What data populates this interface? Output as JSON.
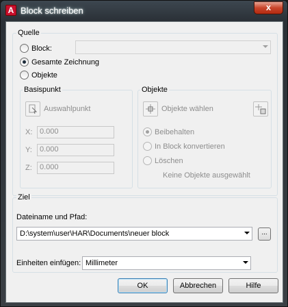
{
  "window": {
    "title": "Block schreiben",
    "close_glyph": "x",
    "app_icon_letter": "A"
  },
  "quelle": {
    "title": "Quelle",
    "options": [
      "Block:",
      "Gesamte Zeichnung",
      "Objekte"
    ],
    "selected": "Gesamte Zeichnung",
    "block_combo_value": ""
  },
  "basispunkt": {
    "title": "Basispunkt",
    "pick_label": "Auswahlpunkt",
    "x_label": "X:",
    "y_label": "Y:",
    "z_label": "Z:",
    "x_value": "0.000",
    "y_value": "0.000",
    "z_value": "0.000"
  },
  "objekte": {
    "title": "Objekte",
    "select_label": "Objekte wählen",
    "options": [
      "Beibehalten",
      "In Block konvertieren",
      "Löschen"
    ],
    "selected": "Beibehalten",
    "status": "Keine Objekte ausgewählt"
  },
  "ziel": {
    "title": "Ziel",
    "path_label": "Dateiname und Pfad:",
    "path_value": "D:\\system\\user\\HAR\\Documents\\neuer block",
    "browse_label": "...",
    "units_label": "Einheiten einfügen:",
    "units_value": "Millimeter"
  },
  "buttons": {
    "ok": "OK",
    "cancel": "Abbrechen",
    "help": "Hilfe"
  },
  "colors": {
    "accent_red": "#c8102e",
    "dialog_bg": "#f0f0f0"
  }
}
